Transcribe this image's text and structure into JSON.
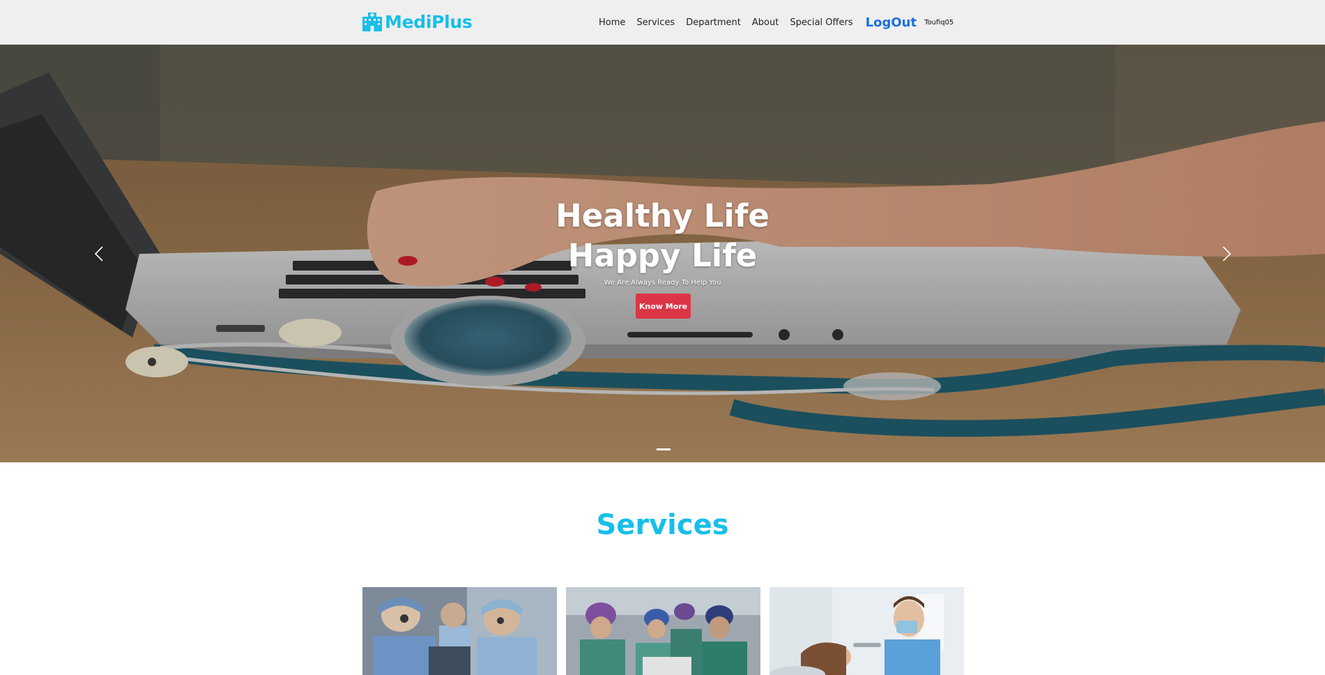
{
  "navbar": {
    "brand": "MediPlus",
    "brand_icon": "hospital-building-icon",
    "links": [
      "Home",
      "Services",
      "Department",
      "About",
      "Special Offers"
    ],
    "logout": "LogOut",
    "username": "Toufiq05"
  },
  "hero": {
    "title_line1": "Healthy Life",
    "title_line2": "Happy Life",
    "subtitle": "We Are Always Ready To Help You",
    "button": "Know More",
    "prev_icon": "chevron-left-icon",
    "next_icon": "chevron-right-icon"
  },
  "services": {
    "title": "Services"
  },
  "colors": {
    "brand": "#17bfe8",
    "logout": "#1a6fe0",
    "button": "#dc3545",
    "navbar_bg": "#efefef"
  }
}
